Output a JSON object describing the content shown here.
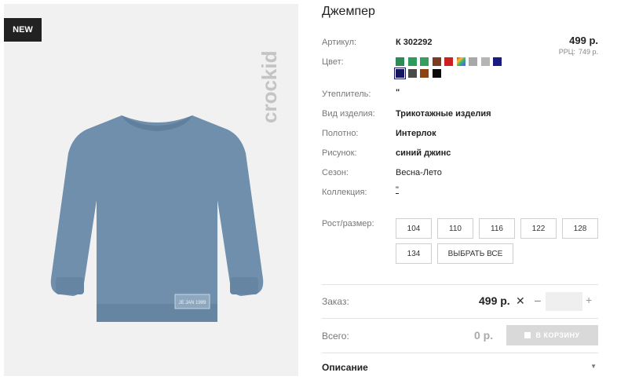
{
  "badge": {
    "label": "NEW"
  },
  "brand": {
    "logo_text": "crockid"
  },
  "product": {
    "title": "Джемпер",
    "price": "499 р.",
    "rrp_label": "РРЦ:",
    "rrp_value": "749 р.",
    "fields": {
      "article": {
        "label": "Артикул:",
        "value": "К 302292"
      },
      "color": {
        "label": "Цвет:"
      },
      "insulation": {
        "label": "Утеплитель:",
        "value": "\""
      },
      "type": {
        "label": "Вид изделия:",
        "value": "Трикотажные изделия"
      },
      "fabric": {
        "label": "Полотно:",
        "value": "Интерлок"
      },
      "pattern": {
        "label": "Рисунок:",
        "value": "синий джинс"
      },
      "season": {
        "label": "Сезон:",
        "value": "Весна-Лето"
      },
      "collection": {
        "label": "Коллекция:",
        "value": "\""
      },
      "size": {
        "label": "Рост/размер:"
      }
    },
    "photo_patch_text": "JE JAN 1989"
  },
  "colors": [
    {
      "hex": "#2e8b57",
      "selected": false
    },
    {
      "hex": "#2f9a5e",
      "selected": false
    },
    {
      "hex": "#34a05f",
      "selected": false
    },
    {
      "hex": "#7a3b1e",
      "selected": false
    },
    {
      "hex": "#cc1f1f",
      "selected": false
    },
    {
      "hex": "multicolor",
      "selected": false
    },
    {
      "hex": "#a8a8a8",
      "selected": false
    },
    {
      "hex": "#b5b5b5",
      "selected": false
    },
    {
      "hex": "#1a1a80",
      "selected": false
    },
    {
      "hex": "#151560",
      "selected": true
    },
    {
      "hex": "#4a4a4a",
      "selected": false
    },
    {
      "hex": "#8b4513",
      "selected": false
    },
    {
      "hex": "#0a0a0a",
      "selected": false
    }
  ],
  "sizes": [
    "104",
    "110",
    "116",
    "122",
    "128",
    "134"
  ],
  "select_all_label": "ВЫБРАТЬ ВСЕ",
  "order": {
    "label": "Заказ:",
    "price": "499 р.",
    "remove_symbol": "✕",
    "minus": "–",
    "plus": "+",
    "quantity": ""
  },
  "total": {
    "label": "Всего:",
    "value": "0 р."
  },
  "cart_button": {
    "label": "В КОРЗИНУ"
  },
  "description": {
    "label": "Описание",
    "chevron": "▼"
  }
}
